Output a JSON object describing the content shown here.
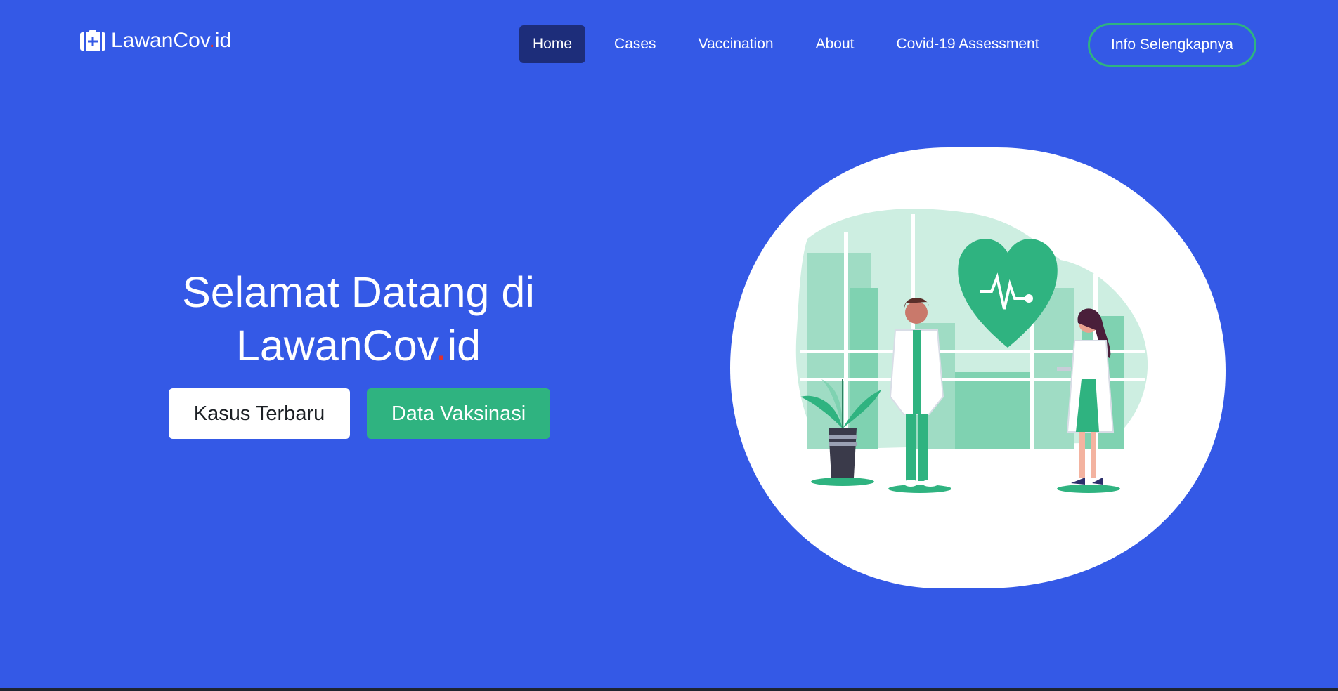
{
  "brand": {
    "name_part1": "LawanCov",
    "name_dot": ".",
    "name_part2": "id",
    "icon": "medical-kit-icon"
  },
  "nav": {
    "items": [
      {
        "label": "Home",
        "active": true
      },
      {
        "label": "Cases",
        "active": false
      },
      {
        "label": "Vaccination",
        "active": false
      },
      {
        "label": "About",
        "active": false
      },
      {
        "label": "Covid-19 Assessment",
        "active": false
      }
    ],
    "cta_label": "Info Selengkapnya"
  },
  "hero": {
    "title_line1": "Selamat Datang di",
    "title_line2_part1": "LawanCov",
    "title_line2_dot": ".",
    "title_line2_part2": "id",
    "button_primary": "Kasus Terbaru",
    "button_secondary": "Data Vaksinasi",
    "illustration": "doctors-heart-illustration"
  },
  "colors": {
    "background": "#3459e6",
    "accent_green": "#2fb380",
    "nav_active": "#1d2d7a",
    "brand_dot": "#e0312f"
  }
}
